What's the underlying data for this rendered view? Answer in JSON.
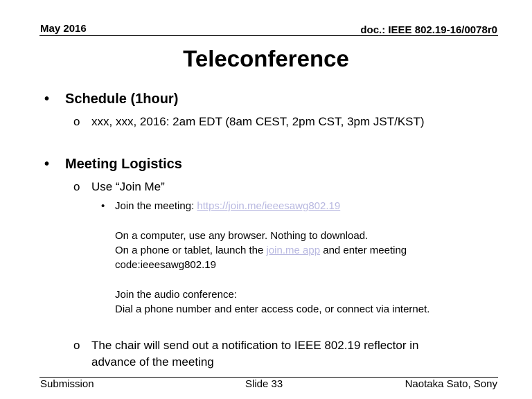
{
  "header": {
    "date": "May 2016",
    "doc_id": "doc.: IEEE 802.19-16/0078r0"
  },
  "title": "Teleconference",
  "bullets": {
    "schedule": {
      "label": "Schedule (1hour)",
      "sub": "xxx, xxx, 2016: 2am EDT (8am CEST, 2pm CST, 3pm JST/KST)"
    },
    "logistics": {
      "label": "Meeting Logistics",
      "join_me": {
        "label": "Use “Join Me”",
        "join_prefix": "Join the meeting: ",
        "join_link": "https://join.me/ieeesawg802.19",
        "computer_line": "On a computer, use any browser. Nothing to download.",
        "phone_prefix": "On a phone or tablet, launch the ",
        "phone_link": "join.me app",
        "phone_suffix": " and enter meeting",
        "code_line": "code:ieeesawg802.19",
        "audio_line1": "Join the audio conference:",
        "audio_line2": "Dial a phone number and enter access code, or connect via internet."
      },
      "notification_line1": "The chair will send out a notification to IEEE 802.19 reflector in",
      "notification_line2": "advance of the meeting"
    }
  },
  "footer": {
    "left": "Submission",
    "center": "Slide 33",
    "right": "Naotaka Sato, Sony"
  },
  "glyphs": {
    "bullet": "•",
    "circle": "o"
  }
}
